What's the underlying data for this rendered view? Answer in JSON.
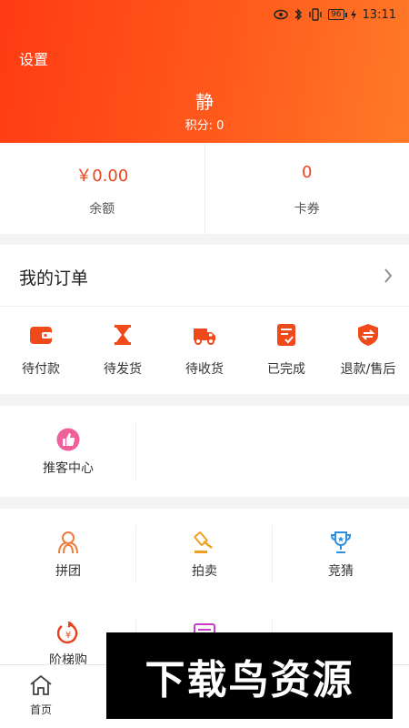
{
  "status_bar": {
    "battery": "96",
    "time": "13:11"
  },
  "header": {
    "settings_label": "设置",
    "user_name": "静",
    "points_label": "积分:  0"
  },
  "balance": [
    {
      "value": "￥0.00",
      "label": "余额"
    },
    {
      "value": "0",
      "label": "卡券"
    }
  ],
  "orders": {
    "title": "我的订单",
    "items": [
      {
        "label": "待付款",
        "icon": "wallet-icon"
      },
      {
        "label": "待发货",
        "icon": "hourglass-icon"
      },
      {
        "label": "待收货",
        "icon": "truck-icon"
      },
      {
        "label": "已完成",
        "icon": "checklist-icon"
      },
      {
        "label": "退款/售后",
        "icon": "refund-shield-icon"
      }
    ]
  },
  "recommend": {
    "label": "推客中心",
    "icon": "thumbs-up-icon"
  },
  "tools": [
    {
      "label": "拼团",
      "icon": "group-icon"
    },
    {
      "label": "拍卖",
      "icon": "gavel-icon"
    },
    {
      "label": "竞猜",
      "icon": "trophy-icon"
    },
    {
      "label": "阶梯购",
      "icon": "tier-price-icon"
    }
  ],
  "bottom_nav": {
    "home_label": "首页"
  },
  "watermark": {
    "text": "下载鸟资源"
  },
  "colors": {
    "accent": "#ff4a17",
    "price": "#e8461e"
  }
}
